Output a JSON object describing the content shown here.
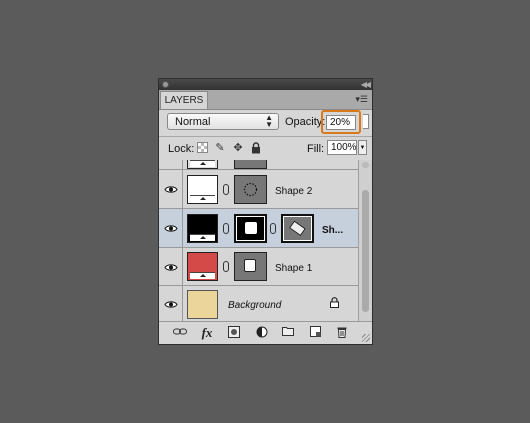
{
  "panel": {
    "tab_label": "LAYERS",
    "blend_mode": "Normal",
    "opacity_label": "Opacity:",
    "opacity_value": "20%",
    "lock_label": "Lock:",
    "fill_label": "Fill:",
    "fill_value": "100%"
  },
  "layers": [
    {
      "name": "Shape 2",
      "thumb_color": "#ffffff"
    },
    {
      "name": "Sh...",
      "thumb_color": "#000000",
      "selected": true
    },
    {
      "name": "Shape 1",
      "thumb_color": "#d44a48"
    },
    {
      "name": "Background",
      "thumb_color": "#ecd59a"
    }
  ],
  "colors": {
    "background": "#5b5b5b",
    "panel": "#d6d6d6",
    "selected_row": "#c6d0dd",
    "highlight": "#d87a1c"
  },
  "icons": [
    "eye-icon",
    "chain-link-icon",
    "lock-icon",
    "brush-icon",
    "move-icon",
    "fx-icon",
    "mask-icon",
    "adjustment-icon",
    "folder-icon",
    "new-layer-icon",
    "trash-icon"
  ]
}
